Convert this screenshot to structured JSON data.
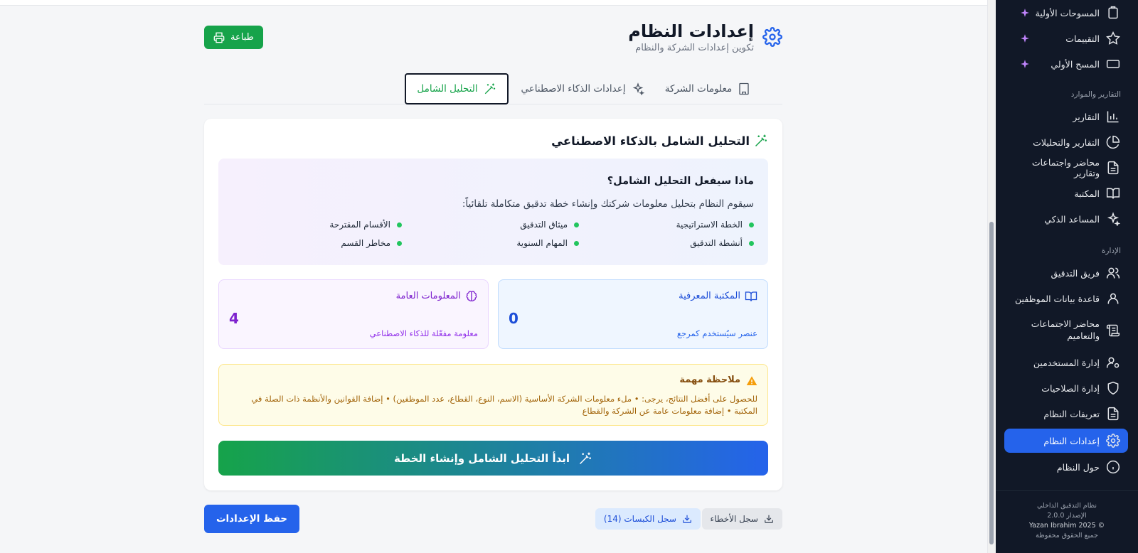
{
  "header": {
    "title": "إعدادات النظام",
    "subtitle": "تكوين إعدادات الشركة والنظام",
    "print_label": "طباعة"
  },
  "tabs": [
    {
      "label": "معلومات الشركة",
      "icon": "building-icon"
    },
    {
      "label": "إعدادات الذكاء الاصطناعي",
      "icon": "sparkles-icon"
    },
    {
      "label": "التحليل الشامل",
      "icon": "magic-wand-icon",
      "active": true
    }
  ],
  "card": {
    "title": "التحليل الشامل بالذكاء الاصطناعي",
    "what_title": "ماذا سيفعل التحليل الشامل؟",
    "what_desc": "سيقوم النظام بتحليل معلومات شركتك وإنشاء خطة تدقيق متكاملة تلقائياً:",
    "bullets": [
      "الخطة الاستراتيجية",
      "ميثاق التدقيق",
      "الأقسام المقترحة",
      "أنشطة التدقيق",
      "المهام السنوية",
      "مخاطر القسم"
    ],
    "knowledge": {
      "label": "المكتبة المعرفية",
      "value": "0",
      "sub": "عنصر سيُستخدم كمرجع"
    },
    "general": {
      "label": "المعلومات العامة",
      "value": "4",
      "sub": "معلومة مفعّلة للذكاء الاصطناعي"
    },
    "note_title": "ملاحظة مهمة",
    "note_body": "للحصول على أفضل النتائج، يرجى: • ملء معلومات الشركة الأساسية (الاسم، النوع، القطاع، عدد الموظفين) • إضافة القوانين والأنظمة ذات الصلة في المكتبة • إضافة معلومات عامة عن الشركة والقطاع",
    "start_label": "ابدأ التحليل الشامل وإنشاء الخطة"
  },
  "footer_actions": {
    "save_label": "حفظ الإعدادات",
    "errors_log": "سجل الأخطاء",
    "presses_log": "سجل الكبسات (14)"
  },
  "sidebar": {
    "top_items": [
      {
        "label": "المسوحات الأولية",
        "icon": "clipboard-icon"
      },
      {
        "label": "التقييمات",
        "icon": "star-icon"
      },
      {
        "label": "المسح الأولي",
        "icon": "scan-icon"
      }
    ],
    "section_reports": "التقارير والموارد",
    "report_items": [
      {
        "label": "التقارير",
        "icon": "bar-chart-icon"
      },
      {
        "label": "التقارير والتحليلات",
        "icon": "pie-chart-icon"
      },
      {
        "label": "محاضر واجتماعات وتقارير",
        "icon": "document-icon"
      },
      {
        "label": "المكتبة",
        "icon": "book-icon"
      },
      {
        "label": "المساعد الذكي",
        "icon": "sparkles-icon"
      }
    ],
    "section_admin": "الإدارة",
    "admin_items": [
      {
        "label": "فريق التدقيق",
        "icon": "users-icon"
      },
      {
        "label": "قاعدة بيانات الموظفين",
        "icon": "user-icon"
      },
      {
        "label": "محاضر الاجتماعات والتعاميم",
        "icon": "scroll-icon"
      },
      {
        "label": "إدارة المستخدمين",
        "icon": "user-cog-icon"
      },
      {
        "label": "إدارة الصلاحيات",
        "icon": "shield-icon"
      },
      {
        "label": "تعريفات النظام",
        "icon": "file-text-icon"
      },
      {
        "label": "إعدادات النظام",
        "icon": "gear-icon",
        "active": true
      },
      {
        "label": "حول النظام",
        "icon": "info-icon"
      }
    ],
    "footer": {
      "line1": "نظام التدقيق الداخلي",
      "line2": "الإصدار 2.0.0",
      "line3": "© Yazan Ibrahim 2025",
      "line4": "جميع الحقوق محفوظة"
    }
  },
  "colors": {
    "accent": "#2563eb",
    "success": "#16a34a",
    "sidebar_bg": "#111827"
  }
}
